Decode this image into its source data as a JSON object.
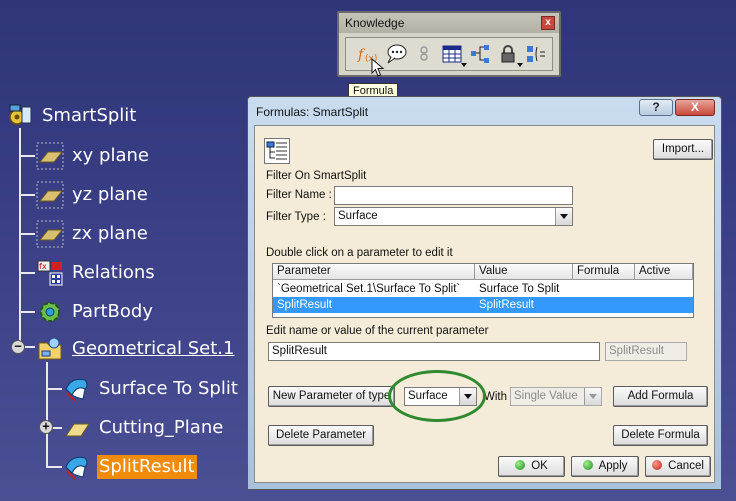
{
  "tree": {
    "root": "SmartSplit",
    "items": [
      {
        "label": "xy plane",
        "icon": "plane-icon"
      },
      {
        "label": "yz plane",
        "icon": "plane-icon"
      },
      {
        "label": "zx plane",
        "icon": "plane-icon"
      },
      {
        "label": "Relations",
        "icon": "relations-icon"
      },
      {
        "label": "PartBody",
        "icon": "part-body-icon"
      },
      {
        "label": "Geometrical Set.1",
        "icon": "geometrical-set-icon",
        "expander": "−"
      }
    ],
    "children": [
      {
        "label": "Surface To Split",
        "icon": "surface-icon"
      },
      {
        "label": "Cutting_Plane",
        "icon": "cutting-plane-icon",
        "expander": "+"
      },
      {
        "label": "SplitResult",
        "icon": "surface-icon",
        "selected": true
      }
    ]
  },
  "toolbar": {
    "title": "Knowledge",
    "close": "x",
    "tooltip": "Formula",
    "buttons": [
      "formula-icon",
      "comment-icon",
      "parameter-icon",
      "table-icon",
      "tree-icon",
      "lock-icon",
      "equivalence-icon"
    ]
  },
  "dialog": {
    "title": "Formulas: SmartSplit",
    "help": "?",
    "close": "X",
    "import": "Import...",
    "filter_on": "Filter On SmartSplit",
    "filter_name_label": "Filter Name :",
    "filter_name_value": "",
    "filter_type_label": "Filter Type :",
    "filter_type_value": "Surface",
    "double_click_hint": "Double click on a parameter to edit it",
    "columns": [
      "Parameter",
      "Value",
      "Formula",
      "Active"
    ],
    "rows": [
      {
        "parameter": "`Geometrical Set.1\\Surface To Split`",
        "value": "Surface To Split",
        "formula": "",
        "active": "",
        "selected": false
      },
      {
        "parameter": "SplitResult",
        "value": "SplitResult",
        "formula": "",
        "active": "",
        "selected": true
      }
    ],
    "edit_label": "Edit name or value of the current parameter",
    "edit_name": "SplitResult",
    "edit_value": "SplitResult",
    "new_param": "New Parameter of type",
    "new_param_type": "Surface",
    "with_label": "With",
    "with_value": "Single Value",
    "add_formula": "Add Formula",
    "delete_param": "Delete Parameter",
    "delete_formula": "Delete Formula",
    "ok": "OK",
    "apply": "Apply",
    "cancel": "Cancel"
  },
  "colors": {
    "background": "#3a3f86",
    "selection": "#f28a0a",
    "highlight_ring": "#2f8a2f",
    "list_selection": "#3399ff"
  }
}
